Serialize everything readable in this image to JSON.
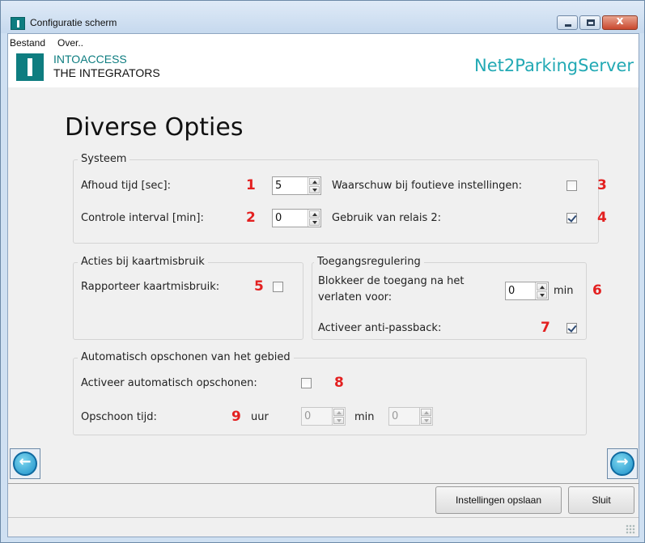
{
  "window": {
    "title": "Configuratie scherm",
    "controls": {
      "minimize": "minimize",
      "maximize": "maximize",
      "close": "x"
    }
  },
  "menu": [
    "Bestand",
    "Over.."
  ],
  "banner": {
    "logo_line1": "INTOACCESS",
    "logo_line2": "THE INTEGRATORS",
    "app_name": "Net2ParkingServer"
  },
  "page_title": "Diverse Opties",
  "systeem": {
    "title": "Systeem",
    "afhoud_label": "Afhoud tijd [sec]:",
    "afhoud_num": "1",
    "afhoud_value": "5",
    "controle_label": "Controle interval [min]:",
    "controle_num": "2",
    "controle_value": "0",
    "waarschuw_label": "Waarschuw bij foutieve instellingen:",
    "waarschuw_num": "3",
    "waarschuw_checked": false,
    "relais_label": "Gebruik van relais 2:",
    "relais_num": "4",
    "relais_checked": true
  },
  "acties": {
    "title": "Acties bij kaartmisbruik",
    "rapporteer_label": "Rapporteer kaartmisbruik:",
    "rapporteer_num": "5",
    "rapporteer_checked": false
  },
  "toegang": {
    "title": "Toegangsregulering",
    "blokkeer_line1": "Blokkeer de toegang na het",
    "blokkeer_line2": "verlaten voor:",
    "blokkeer_value": "0",
    "blokkeer_unit": "min",
    "blokkeer_num": "6",
    "antipassback_label": "Activeer anti-passback:",
    "antipassback_num": "7",
    "antipassback_checked": true
  },
  "opschonen": {
    "title": "Automatisch opschonen van het gebied",
    "activeer_label": "Activeer automatisch opschonen:",
    "activeer_num": "8",
    "activeer_checked": false,
    "tijd_label": "Opschoon tijd:",
    "tijd_num": "9",
    "uur_label": "uur",
    "uur_value": "0",
    "min_label": "min",
    "min_value": "0"
  },
  "nav": {
    "back_icon": "arrow-left-icon",
    "forward_icon": "arrow-right-icon"
  },
  "buttons": {
    "save": "Instellingen opslaan",
    "close": "Sluit"
  }
}
